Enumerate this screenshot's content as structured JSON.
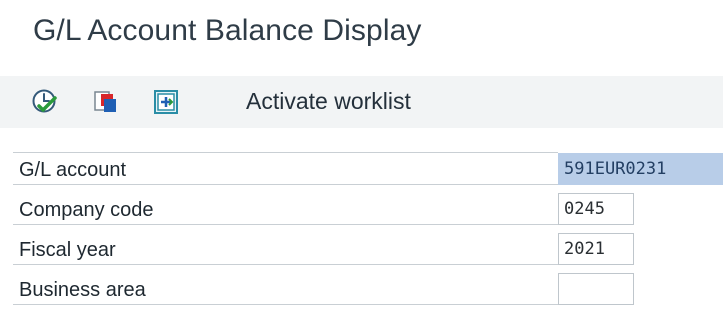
{
  "header": {
    "title": "G/L Account Balance Display"
  },
  "toolbar": {
    "icons": [
      "execute-icon",
      "copy-icon",
      "worklist-icon"
    ],
    "activate_worklist_label": "Activate worklist"
  },
  "form": {
    "rows": [
      {
        "label": "G/L account",
        "value": "591EUR0231"
      },
      {
        "label": "Company code",
        "value": "0245"
      },
      {
        "label": "Fiscal year",
        "value": "2021"
      },
      {
        "label": "Business area",
        "value": ""
      }
    ]
  },
  "colors": {
    "selected_field_bg": "#b8cde8",
    "toolbar_bg": "#f2f4f5",
    "execute_icon_green": "#2b9a3c",
    "copy_icon_red": "#d8262a",
    "copy_icon_blue": "#1f5fb4",
    "worklist_icon_teal": "#2a8da6"
  }
}
